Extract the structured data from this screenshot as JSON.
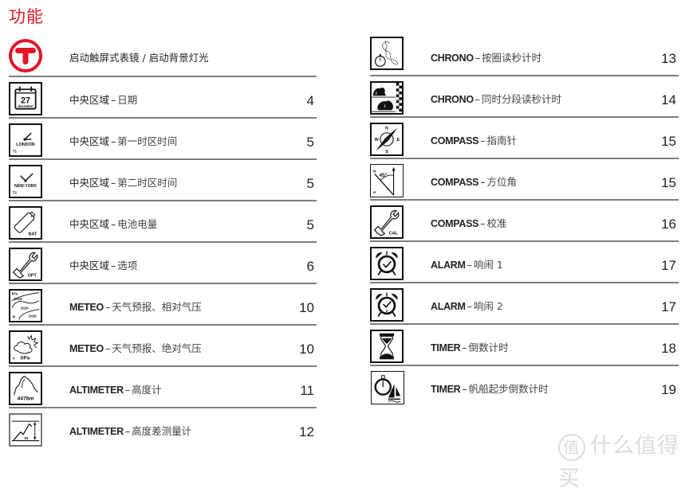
{
  "page_title": "功能",
  "accent_color": "#e3142a",
  "left_column": [
    {
      "icon": "touch-t-icon",
      "title": "",
      "separator": "",
      "desc": "启动触屏式表镜 / 启动背景灯光",
      "page": ""
    },
    {
      "icon": "calendar-icon",
      "icon_text": [
        "27",
        "december"
      ],
      "title": "中央区域",
      "separator": "–",
      "desc": "日期",
      "page": "4"
    },
    {
      "icon": "time-zone-london-icon",
      "icon_text": [
        "LONDON",
        "T1"
      ],
      "title": "中央区域",
      "separator": "–",
      "desc": "第一时区时间",
      "page": "5"
    },
    {
      "icon": "time-zone-newyork-icon",
      "icon_text": [
        "NEW-YORK",
        "T2"
      ],
      "title": "中央区域",
      "separator": "–",
      "desc": "第二时区时间",
      "page": "5"
    },
    {
      "icon": "battery-icon",
      "icon_text": [
        "BAT"
      ],
      "title": "中央区域",
      "separator": "–",
      "desc": "电池电量",
      "page": "5"
    },
    {
      "icon": "wrench-options-icon",
      "icon_text": [
        "OPT"
      ],
      "title": "中央区域",
      "separator": "–",
      "desc": "选项",
      "page": "6"
    },
    {
      "icon": "isobar-pressure-icon",
      "icon_text": [
        "hPa",
        "1015",
        "1020",
        "1025",
        "R"
      ],
      "title": "METEO",
      "separator": "–",
      "desc": "天气预报、相对气压",
      "page": "10"
    },
    {
      "icon": "weather-cloud-sun-icon",
      "icon_text": [
        "A",
        "hPa"
      ],
      "title": "METEO",
      "separator": "–",
      "desc": "天气预报、绝对气压",
      "page": "10"
    },
    {
      "icon": "mountain-altitude-icon",
      "icon_text": [
        "4478m"
      ],
      "title": "ALTIMETER",
      "separator": "–",
      "desc": "高度计",
      "page": "11"
    },
    {
      "icon": "altitude-difference-icon",
      "icon_text": [
        "m"
      ],
      "title": "ALTIMETER",
      "separator": "–",
      "desc": "高度差测量计",
      "page": "12"
    }
  ],
  "right_column": [
    {
      "icon": "lap-chrono-icon",
      "title": "CHRONO",
      "separator": "–",
      "desc": "按圈读秒计时",
      "page": "13"
    },
    {
      "icon": "split-chrono-icon",
      "icon_text": [
        "2",
        "1"
      ],
      "title": "CHRONO",
      "separator": "–",
      "desc": "同时分段读秒计时",
      "page": "14"
    },
    {
      "icon": "compass-icon",
      "icon_text": [
        "N",
        "W",
        "E",
        "S"
      ],
      "title": "COMPASS",
      "separator": "–",
      "desc": "指南针",
      "page": "15"
    },
    {
      "icon": "bearing-icon",
      "icon_text": [
        "N",
        "45°",
        "A"
      ],
      "title": "COMPASS",
      "separator": "–",
      "desc": "方位角",
      "page": "15"
    },
    {
      "icon": "wrench-calibrate-icon",
      "icon_text": [
        "CAL"
      ],
      "title": "COMPASS",
      "separator": "–",
      "desc": "校准",
      "page": "16"
    },
    {
      "icon": "alarm-clock-1-icon",
      "title": "ALARM",
      "separator": "–",
      "desc": "响闹 1",
      "page": "17"
    },
    {
      "icon": "alarm-clock-2-icon",
      "icon_text": [
        "2"
      ],
      "title": "ALARM",
      "separator": "–",
      "desc": "响闹 2",
      "page": "17"
    },
    {
      "icon": "hourglass-icon",
      "title": "TIMER",
      "separator": "–",
      "desc": "倒数计时",
      "page": "18"
    },
    {
      "icon": "regatta-timer-icon",
      "title": "TIMER",
      "separator": "–",
      "desc": "帆船起步倒数计时",
      "page": "19"
    }
  ],
  "watermark": {
    "symbol": "值",
    "text": "什么值得买"
  }
}
